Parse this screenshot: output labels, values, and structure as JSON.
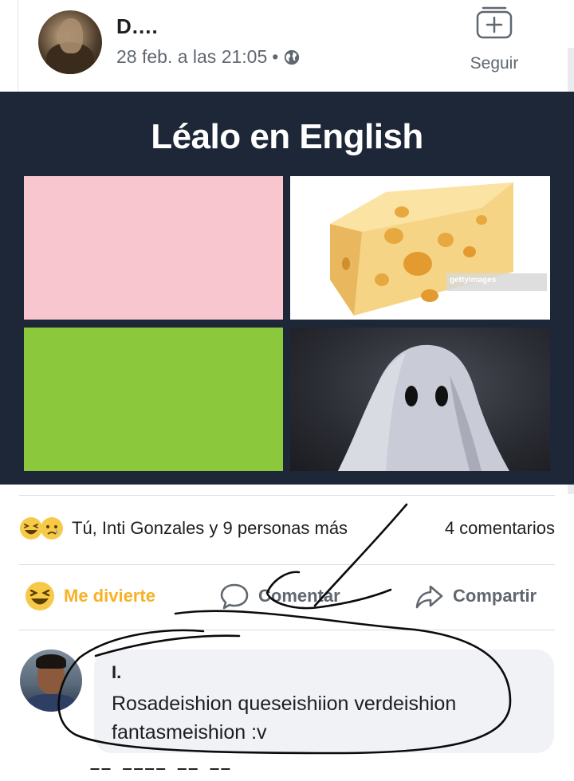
{
  "post": {
    "author": "D....",
    "timestamp": "28 feb. a las 21:05",
    "separator": "•",
    "privacy_icon": "globe-icon",
    "follow": {
      "icon": "follow-plus-icon",
      "label": "Seguir"
    }
  },
  "meme": {
    "title": "Léalo en English",
    "panels": [
      {
        "name": "pink-panel",
        "color": "#f7c6cf"
      },
      {
        "name": "cheese-panel",
        "watermark": "gettyimages"
      },
      {
        "name": "green-panel",
        "color": "#8cc83c"
      },
      {
        "name": "ghost-panel"
      }
    ]
  },
  "reactions": {
    "icons": [
      "haha-emoji",
      "sad-emoji"
    ],
    "summary": "Tú, Inti Gonzales y 9 personas más",
    "comments_count": "4 comentarios"
  },
  "actions": {
    "react_label": "Me divierte",
    "comment_label": "Comentar",
    "share_label": "Compartir"
  },
  "comment": {
    "author": "I.",
    "text": "Rosadeishion queseishiion verdeishion fantasmeishion  :v"
  },
  "colors": {
    "meme_bg": "#1d2737",
    "react_yellow": "#f7b125",
    "muted_text": "#606770",
    "bubble_bg": "#f0f2f5"
  }
}
